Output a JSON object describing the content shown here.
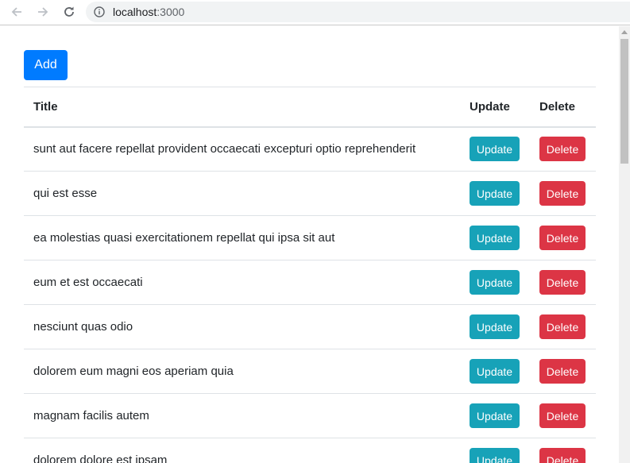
{
  "browser": {
    "url_host": "localhost",
    "url_port": ":3000"
  },
  "page": {
    "add_label": "Add",
    "table": {
      "headers": {
        "title": "Title",
        "update": "Update",
        "delete": "Delete"
      },
      "rows": [
        {
          "title": "sunt aut facere repellat provident occaecati excepturi optio reprehenderit",
          "update_label": "Update",
          "delete_label": "Delete"
        },
        {
          "title": "qui est esse",
          "update_label": "Update",
          "delete_label": "Delete"
        },
        {
          "title": "ea molestias quasi exercitationem repellat qui ipsa sit aut",
          "update_label": "Update",
          "delete_label": "Delete"
        },
        {
          "title": "eum et est occaecati",
          "update_label": "Update",
          "delete_label": "Delete"
        },
        {
          "title": "nesciunt quas odio",
          "update_label": "Update",
          "delete_label": "Delete"
        },
        {
          "title": "dolorem eum magni eos aperiam quia",
          "update_label": "Update",
          "delete_label": "Delete"
        },
        {
          "title": "magnam facilis autem",
          "update_label": "Update",
          "delete_label": "Delete"
        },
        {
          "title": "dolorem dolore est ipsam",
          "update_label": "Update",
          "delete_label": "Delete"
        }
      ]
    }
  },
  "colors": {
    "primary": "#007bff",
    "info": "#17a2b8",
    "danger": "#dc3545"
  }
}
